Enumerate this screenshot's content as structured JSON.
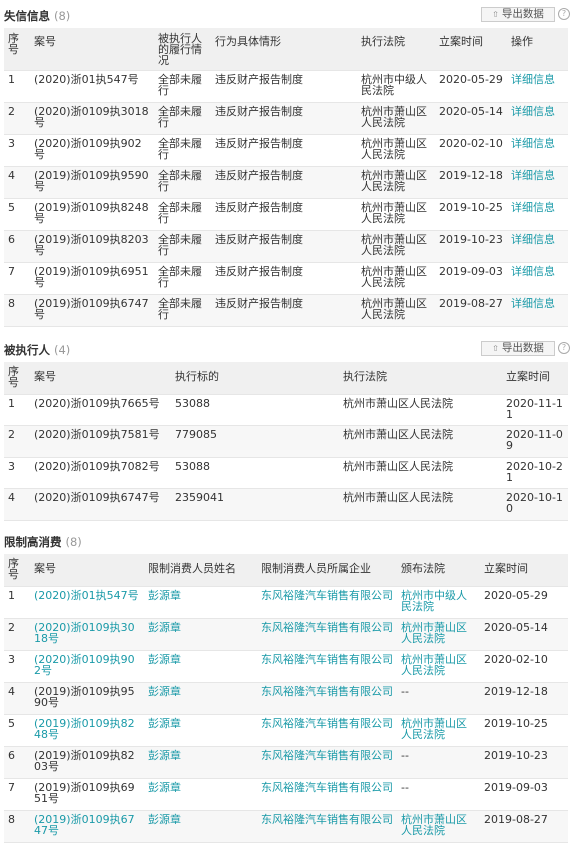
{
  "sections": {
    "shixin": {
      "title": "失信信息",
      "count": "(8)",
      "export_label": "导出数据",
      "headers": [
        "序号",
        "案号",
        "被执行人的履行情况",
        "行为具体情形",
        "执行法院",
        "立案时间",
        "操作"
      ],
      "rows": [
        {
          "no": "1",
          "case": "(2020)浙01执547号",
          "status": "全部未履行",
          "behavior": "违反财产报告制度",
          "court": "杭州市中级人民法院",
          "date": "2020-05-29",
          "action": "详细信息"
        },
        {
          "no": "2",
          "case": "(2020)浙0109执3018号",
          "status": "全部未履行",
          "behavior": "违反财产报告制度",
          "court": "杭州市萧山区人民法院",
          "date": "2020-05-14",
          "action": "详细信息"
        },
        {
          "no": "3",
          "case": "(2020)浙0109执902号",
          "status": "全部未履行",
          "behavior": "违反财产报告制度",
          "court": "杭州市萧山区人民法院",
          "date": "2020-02-10",
          "action": "详细信息"
        },
        {
          "no": "4",
          "case": "(2019)浙0109执9590号",
          "status": "全部未履行",
          "behavior": "违反财产报告制度",
          "court": "杭州市萧山区人民法院",
          "date": "2019-12-18",
          "action": "详细信息"
        },
        {
          "no": "5",
          "case": "(2019)浙0109执8248号",
          "status": "全部未履行",
          "behavior": "违反财产报告制度",
          "court": "杭州市萧山区人民法院",
          "date": "2019-10-25",
          "action": "详细信息"
        },
        {
          "no": "6",
          "case": "(2019)浙0109执8203号",
          "status": "全部未履行",
          "behavior": "违反财产报告制度",
          "court": "杭州市萧山区人民法院",
          "date": "2019-10-23",
          "action": "详细信息"
        },
        {
          "no": "7",
          "case": "(2019)浙0109执6951号",
          "status": "全部未履行",
          "behavior": "违反财产报告制度",
          "court": "杭州市萧山区人民法院",
          "date": "2019-09-03",
          "action": "详细信息"
        },
        {
          "no": "8",
          "case": "(2019)浙0109执6747号",
          "status": "全部未履行",
          "behavior": "违反财产报告制度",
          "court": "杭州市萧山区人民法院",
          "date": "2019-08-27",
          "action": "详细信息"
        }
      ]
    },
    "beizhixing": {
      "title": "被执行人",
      "count": "(4)",
      "export_label": "导出数据",
      "headers": [
        "序号",
        "案号",
        "执行标的",
        "执行法院",
        "立案时间"
      ],
      "rows": [
        {
          "no": "1",
          "case": "(2020)浙0109执7665号",
          "amount": "53088",
          "court": "杭州市萧山区人民法院",
          "date": "2020-11-11"
        },
        {
          "no": "2",
          "case": "(2020)浙0109执7581号",
          "amount": "779085",
          "court": "杭州市萧山区人民法院",
          "date": "2020-11-09"
        },
        {
          "no": "3",
          "case": "(2020)浙0109执7082号",
          "amount": "53088",
          "court": "杭州市萧山区人民法院",
          "date": "2020-10-21"
        },
        {
          "no": "4",
          "case": "(2020)浙0109执6747号",
          "amount": "2359041",
          "court": "杭州市萧山区人民法院",
          "date": "2020-10-10"
        }
      ]
    },
    "xianzhi": {
      "title": "限制高消费",
      "count": "(8)",
      "headers": [
        "序号",
        "案号",
        "限制消费人员姓名",
        "限制消费人员所属企业",
        "颁布法院",
        "立案时间"
      ],
      "rows": [
        {
          "no": "1",
          "case": "(2020)浙01执547号",
          "person": "彭源章",
          "company": "东风裕隆汽车销售有限公司",
          "court": "杭州市中级人民法院",
          "date": "2020-05-29",
          "case_link": true,
          "court_link": true
        },
        {
          "no": "2",
          "case": "(2020)浙0109执3018号",
          "person": "彭源章",
          "company": "东风裕隆汽车销售有限公司",
          "court": "杭州市萧山区人民法院",
          "date": "2020-05-14",
          "case_link": true,
          "court_link": true
        },
        {
          "no": "3",
          "case": "(2020)浙0109执902号",
          "person": "彭源章",
          "company": "东风裕隆汽车销售有限公司",
          "court": "杭州市萧山区人民法院",
          "date": "2020-02-10",
          "case_link": true,
          "court_link": true
        },
        {
          "no": "4",
          "case": "(2019)浙0109执9590号",
          "person": "彭源章",
          "company": "东风裕隆汽车销售有限公司",
          "court": "--",
          "date": "2019-12-18",
          "case_link": false,
          "court_link": false
        },
        {
          "no": "5",
          "case": "(2019)浙0109执8248号",
          "person": "彭源章",
          "company": "东风裕隆汽车销售有限公司",
          "court": "杭州市萧山区人民法院",
          "date": "2019-10-25",
          "case_link": true,
          "court_link": true
        },
        {
          "no": "6",
          "case": "(2019)浙0109执8203号",
          "person": "彭源章",
          "company": "东风裕隆汽车销售有限公司",
          "court": "--",
          "date": "2019-10-23",
          "case_link": false,
          "court_link": false
        },
        {
          "no": "7",
          "case": "(2019)浙0109执6951号",
          "person": "彭源章",
          "company": "东风裕隆汽车销售有限公司",
          "court": "--",
          "date": "2019-09-03",
          "case_link": false,
          "court_link": false
        },
        {
          "no": "8",
          "case": "(2019)浙0109执6747号",
          "person": "彭源章",
          "company": "东风裕隆汽车销售有限公司",
          "court": "杭州市萧山区人民法院",
          "date": "2019-08-27",
          "case_link": true,
          "court_link": true
        }
      ]
    }
  },
  "icons": {
    "export": "upload-arrow-icon",
    "help": "question-circle-icon"
  },
  "colors": {
    "link": "#1a9aa8",
    "header_bg": "#f0f0f0",
    "muted": "#999999"
  }
}
